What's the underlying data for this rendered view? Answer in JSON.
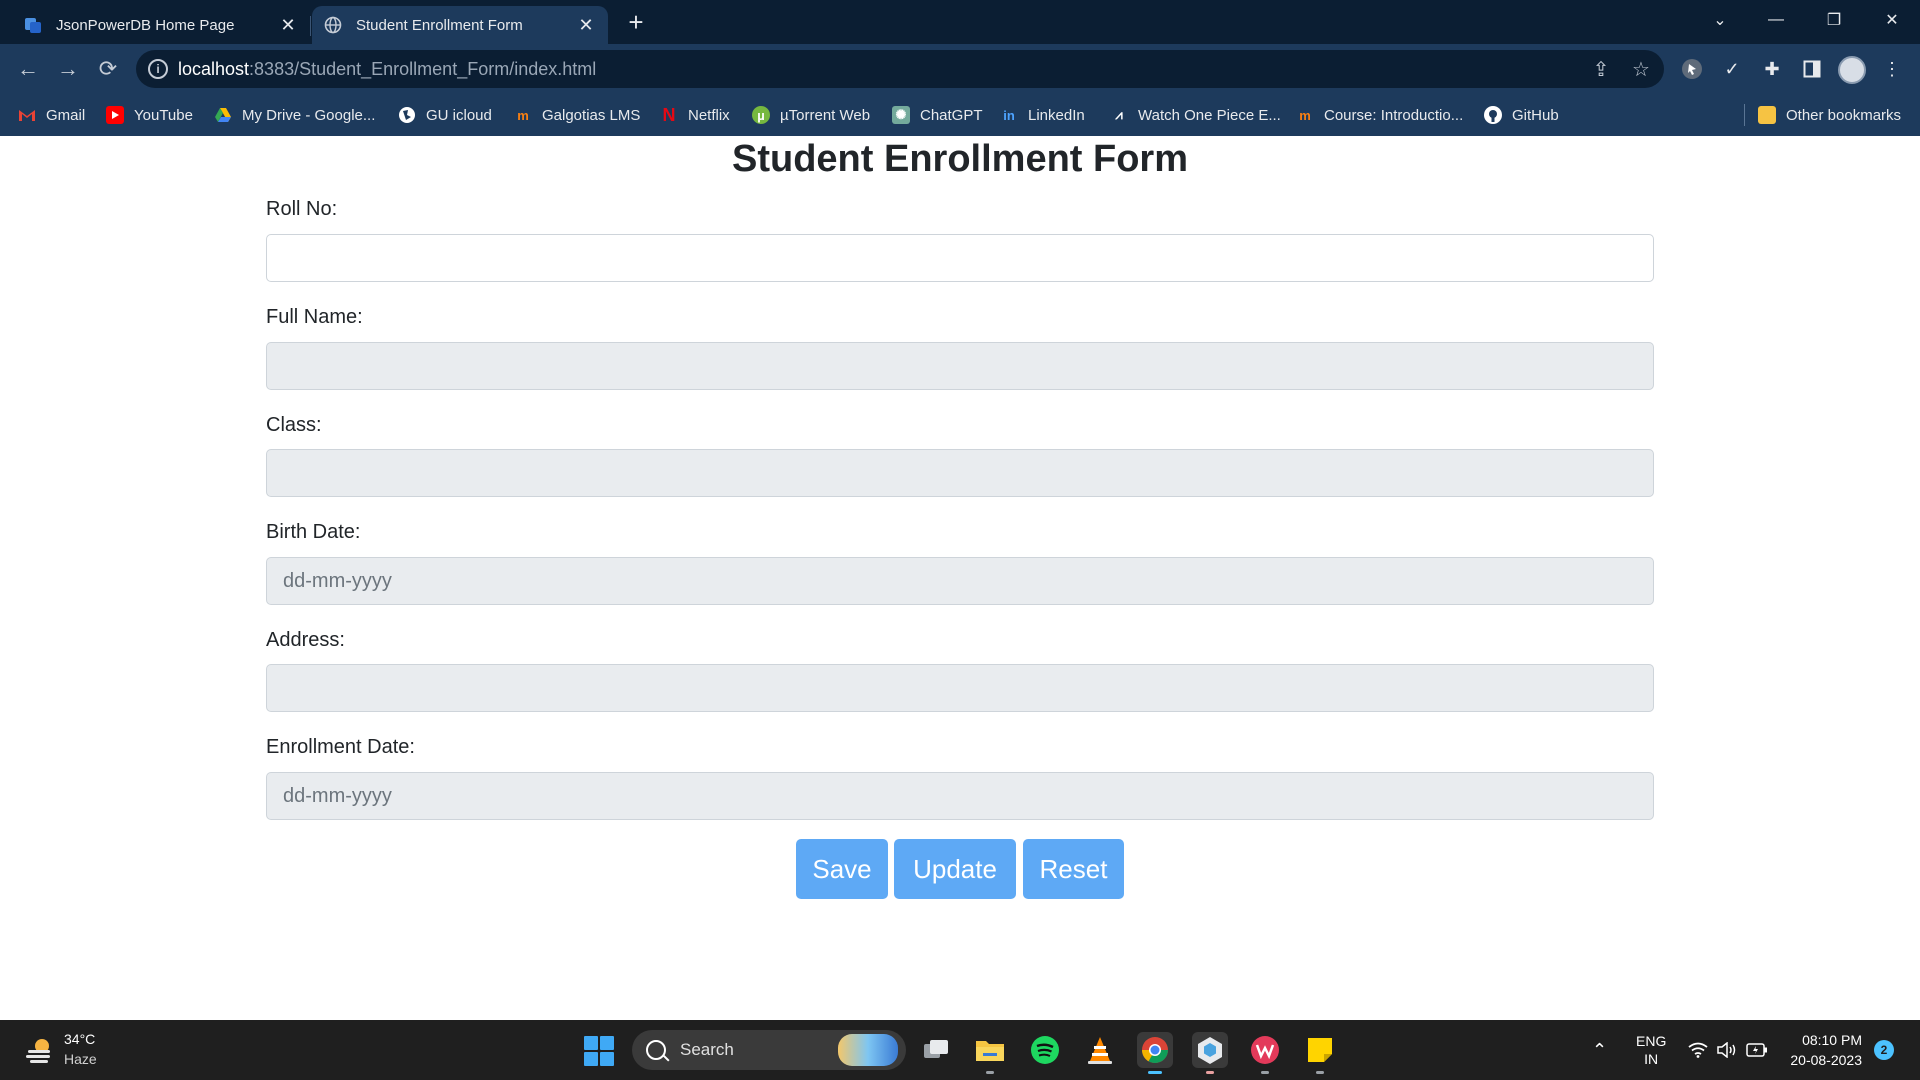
{
  "browser": {
    "tabs": [
      {
        "title": "JsonPowerDB Home Page",
        "active": false
      },
      {
        "title": "Student Enrollment Form",
        "active": true
      }
    ],
    "url": {
      "host": "localhost",
      "rest": ":8383/Student_Enrollment_Form/index.html"
    },
    "bookmarks": [
      {
        "label": "Gmail",
        "icon": "gmail-icon"
      },
      {
        "label": "YouTube",
        "icon": "youtube-icon"
      },
      {
        "label": "My Drive - Google...",
        "icon": "google-drive-icon"
      },
      {
        "label": "GU icloud",
        "icon": "globe-icon"
      },
      {
        "label": "Galgotias LMS",
        "icon": "moodle-icon"
      },
      {
        "label": "Netflix",
        "icon": "netflix-icon"
      },
      {
        "label": "µTorrent Web",
        "icon": "utorrent-icon"
      },
      {
        "label": "ChatGPT",
        "icon": "chatgpt-icon"
      },
      {
        "label": "LinkedIn",
        "icon": "linkedin-icon"
      },
      {
        "label": "Watch One Piece E...",
        "icon": "anime-site-icon"
      },
      {
        "label": "Course: Introductio...",
        "icon": "moodle-icon"
      },
      {
        "label": "GitHub",
        "icon": "github-icon"
      }
    ],
    "other_bookmarks": "Other bookmarks"
  },
  "form": {
    "title": "Student Enrollment Form",
    "fields": [
      {
        "label": "Roll No:",
        "value": "",
        "placeholder": "",
        "enabled": true
      },
      {
        "label": "Full Name:",
        "value": "",
        "placeholder": "",
        "enabled": false
      },
      {
        "label": "Class:",
        "value": "",
        "placeholder": "",
        "enabled": false
      },
      {
        "label": "Birth Date:",
        "value": "",
        "placeholder": "dd-mm-yyyy",
        "enabled": false
      },
      {
        "label": "Address:",
        "value": "",
        "placeholder": "",
        "enabled": false
      },
      {
        "label": "Enrollment Date:",
        "value": "",
        "placeholder": "dd-mm-yyyy",
        "enabled": false
      }
    ],
    "buttons": {
      "save": "Save",
      "update": "Update",
      "reset": "Reset"
    },
    "button_color": "#5ea9f5"
  },
  "taskbar": {
    "weather": {
      "temp": "34°C",
      "condition": "Haze"
    },
    "search_label": "Search",
    "language": {
      "line1": "ENG",
      "line2": "IN"
    },
    "clock": {
      "time": "08:10 PM",
      "date": "20-08-2023"
    },
    "notifications": "2"
  }
}
